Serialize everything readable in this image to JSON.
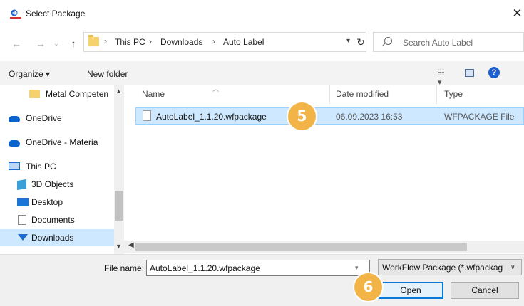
{
  "window": {
    "title": "Select Package"
  },
  "address": {
    "crumbs": [
      "This PC",
      "Downloads",
      "Auto Label"
    ],
    "separator": "›"
  },
  "search": {
    "placeholder": "Search Auto Label"
  },
  "toolbar": {
    "organize": "Organize ▾",
    "new_folder": "New folder"
  },
  "sidebar": {
    "items": [
      {
        "label": "Metal Competen",
        "icon": "folder-icon"
      },
      {
        "label": "OneDrive",
        "icon": "cloud-icon"
      },
      {
        "label": "OneDrive - Materia",
        "icon": "cloud-icon"
      },
      {
        "label": "This PC",
        "icon": "computer-icon"
      },
      {
        "label": "3D Objects",
        "icon": "cube-icon"
      },
      {
        "label": "Desktop",
        "icon": "desktop-icon"
      },
      {
        "label": "Documents",
        "icon": "document-icon"
      },
      {
        "label": "Downloads",
        "icon": "download-arrow-icon"
      }
    ]
  },
  "columns": {
    "name": "Name",
    "date": "Date modified",
    "type": "Type"
  },
  "files": [
    {
      "name": "AutoLabel_1.1.20.wfpackage",
      "date": "06.09.2023 16:53",
      "type": "WFPACKAGE File"
    }
  ],
  "bottom": {
    "file_name_label": "File name:",
    "file_name_value": "AutoLabel_1.1.20.wfpackage",
    "filter": "WorkFlow Package (*.wfpackag",
    "open": "Open",
    "cancel": "Cancel"
  },
  "annotations": {
    "step5": "5",
    "step6": "6"
  },
  "colors": {
    "selection": "#cde8ff",
    "badge": "#f3b447",
    "accent": "#0a78d7"
  }
}
